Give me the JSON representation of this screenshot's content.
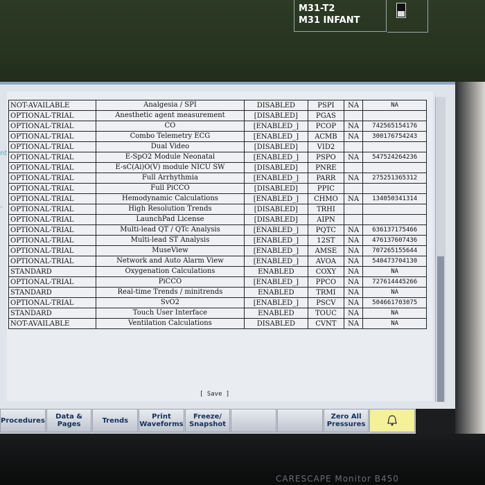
{
  "header": {
    "patient_line1": "M31-T2",
    "patient_line2": "M31 INFANT"
  },
  "side_label": "nt",
  "options_table": {
    "rows": [
      {
        "status": "NOT-AVAILABLE",
        "name": "Analgesia / SPI",
        "state": "DISABLED",
        "code": "PSPI",
        "na": "NA",
        "lic": "NA"
      },
      {
        "status": "OPTIONAL-TRIAL",
        "name": "Anesthetic agent measurement",
        "state": "[DISABLED]",
        "code": "PGAS",
        "na": "",
        "lic": ""
      },
      {
        "status": "OPTIONAL-TRIAL",
        "name": "CO",
        "state": "[ENABLED_]",
        "code": "PCOP",
        "na": "NA",
        "lic": "742565154176"
      },
      {
        "status": "OPTIONAL-TRIAL",
        "name": "Combo Telemetry ECG",
        "state": "[ENABLED_]",
        "code": "ACMB",
        "na": "NA",
        "lic": "300176754243"
      },
      {
        "status": "OPTIONAL-TRIAL",
        "name": "Dual Video",
        "state": "[DISABLED]",
        "code": "VID2",
        "na": "",
        "lic": ""
      },
      {
        "status": "OPTIONAL-TRIAL",
        "name": "E-SpO2 Module Neonatal",
        "state": "[ENABLED_]",
        "code": "PSPO",
        "na": "NA",
        "lic": "547524264236"
      },
      {
        "status": "OPTIONAL-TRIAL",
        "name": "E-sC(Ai)O(V) module NICU SW",
        "state": "[DISABLED]",
        "code": "PNRE",
        "na": "",
        "lic": ""
      },
      {
        "status": "OPTIONAL-TRIAL",
        "name": "Full Arrhythmia",
        "state": "[ENABLED_]",
        "code": "PARR",
        "na": "NA",
        "lic": "275251365312"
      },
      {
        "status": "OPTIONAL-TRIAL",
        "name": "Full PiCCO",
        "state": "[DISABLED]",
        "code": "PPIC",
        "na": "",
        "lic": ""
      },
      {
        "status": "OPTIONAL-TRIAL",
        "name": "Hemodynamic Calculations",
        "state": "[ENABLED_]",
        "code": "CHMO",
        "na": "NA",
        "lic": "134050341314"
      },
      {
        "status": "OPTIONAL-TRIAL",
        "name": "High Resolution Trends",
        "state": "[DISABLED]",
        "code": "TRHI",
        "na": "",
        "lic": ""
      },
      {
        "status": "OPTIONAL-TRIAL",
        "name": "LaunchPad License",
        "state": "[DISABLED]",
        "code": "AIPN",
        "na": "",
        "lic": ""
      },
      {
        "status": "OPTIONAL-TRIAL",
        "name": "Multi-lead QT / QTc Analysis",
        "state": "[ENABLED_]",
        "code": "PQTC",
        "na": "NA",
        "lic": "636137175466"
      },
      {
        "status": "OPTIONAL-TRIAL",
        "name": "Multi-lead ST Analysis",
        "state": "[ENABLED_]",
        "code": "12ST",
        "na": "NA",
        "lic": "476137607436"
      },
      {
        "status": "OPTIONAL-TRIAL",
        "name": "MuseView",
        "state": "[ENABLED_]",
        "code": "AMSE",
        "na": "NA",
        "lic": "707265155644"
      },
      {
        "status": "OPTIONAL-TRIAL",
        "name": "Network and Auto Alarm View",
        "state": "[ENABLED_]",
        "code": "AVOA",
        "na": "NA",
        "lic": "540473704130"
      },
      {
        "status": "STANDARD",
        "name": "Oxygenation Calculations",
        "state": "ENABLED",
        "code": "COXY",
        "na": "NA",
        "lic": "NA"
      },
      {
        "status": "OPTIONAL-TRIAL",
        "name": "PiCCO",
        "state": "[ENABLED_]",
        "code": "PPCO",
        "na": "NA",
        "lic": "727614445266"
      },
      {
        "status": "STANDARD",
        "name": "Real-time Trends / minitrends",
        "state": "ENABLED",
        "code": "TRMI",
        "na": "NA",
        "lic": "NA"
      },
      {
        "status": "OPTIONAL-TRIAL",
        "name": "SvO2",
        "state": "[ENABLED_]",
        "code": "PSCV",
        "na": "NA",
        "lic": "504661703075"
      },
      {
        "status": "STANDARD",
        "name": "Touch User Interface",
        "state": "ENABLED",
        "code": "TOUC",
        "na": "NA",
        "lic": "NA"
      },
      {
        "status": "NOT-AVAILABLE",
        "name": "Ventilation Calculations",
        "state": "DISABLED",
        "code": "CVNT",
        "na": "NA",
        "lic": "NA"
      }
    ]
  },
  "save_label": "[ Save ]",
  "toolbar": {
    "buttons": [
      {
        "label": "Procedures",
        "enabled": true
      },
      {
        "label": "Data & Pages",
        "enabled": true
      },
      {
        "label": "Trends",
        "enabled": true
      },
      {
        "label": "Print Waveforms",
        "enabled": true
      },
      {
        "label": "Freeze/ Snapshot",
        "enabled": true
      },
      {
        "label": "",
        "enabled": false
      },
      {
        "label": "",
        "enabled": false
      },
      {
        "label": "Zero All Pressures",
        "enabled": true
      }
    ],
    "alarm_icon": "alarm-bell-icon"
  },
  "brand": "CARESCAPE Monitor B450",
  "colors": {
    "screen_bg": "#26331f",
    "dialog_bg": "#dfe3ea",
    "button_text": "#14305a",
    "alarm_button": "#f5f09a"
  }
}
